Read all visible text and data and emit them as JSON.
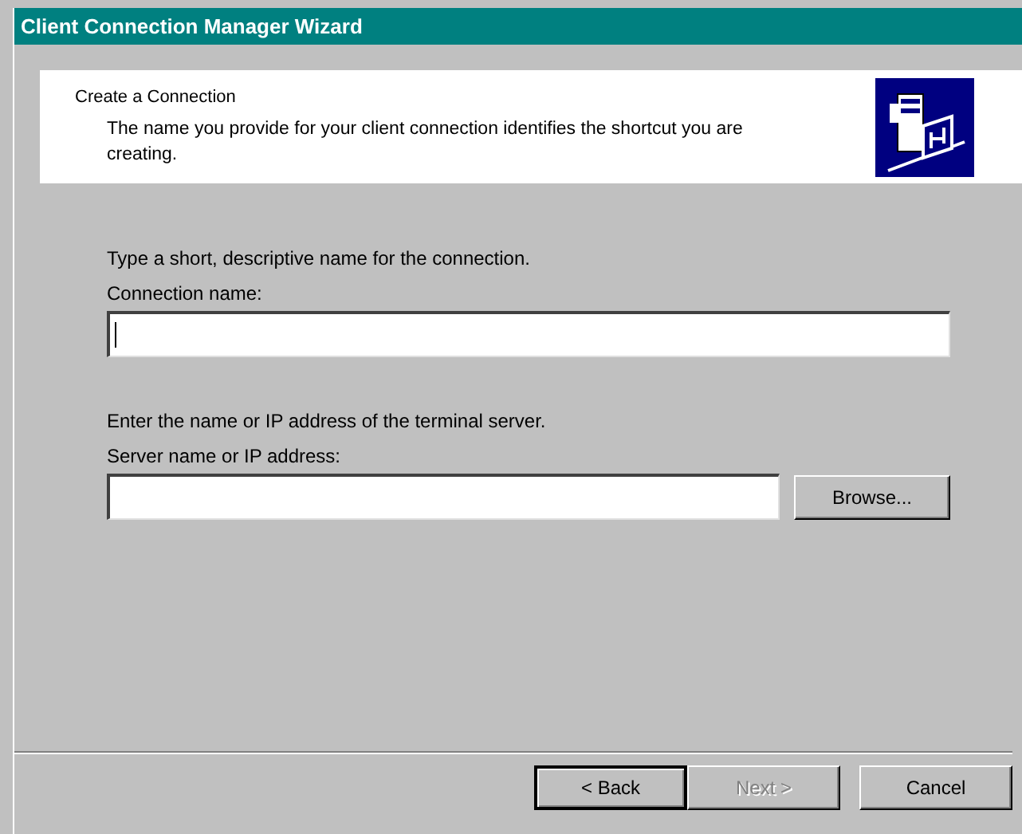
{
  "window": {
    "title": "Client Connection Manager Wizard"
  },
  "header": {
    "title": "Create a Connection",
    "description": "The name you provide for your client connection identifies the shortcut you are creating."
  },
  "sections": [
    {
      "instruction": "Type a short, descriptive name for the connection.",
      "label": "Connection name:",
      "text_cursor": true
    },
    {
      "instruction": "Enter the name or IP address of the terminal server.",
      "label": "Server name or IP address:",
      "button": {
        "label": "Browse..."
      }
    }
  ],
  "buttons": [
    {
      "label": "< Back",
      "disabled": false,
      "default": true
    },
    {
      "label": "Next >",
      "disabled": true,
      "default": false
    },
    {
      "label": "Cancel",
      "disabled": false,
      "default": false
    }
  ]
}
